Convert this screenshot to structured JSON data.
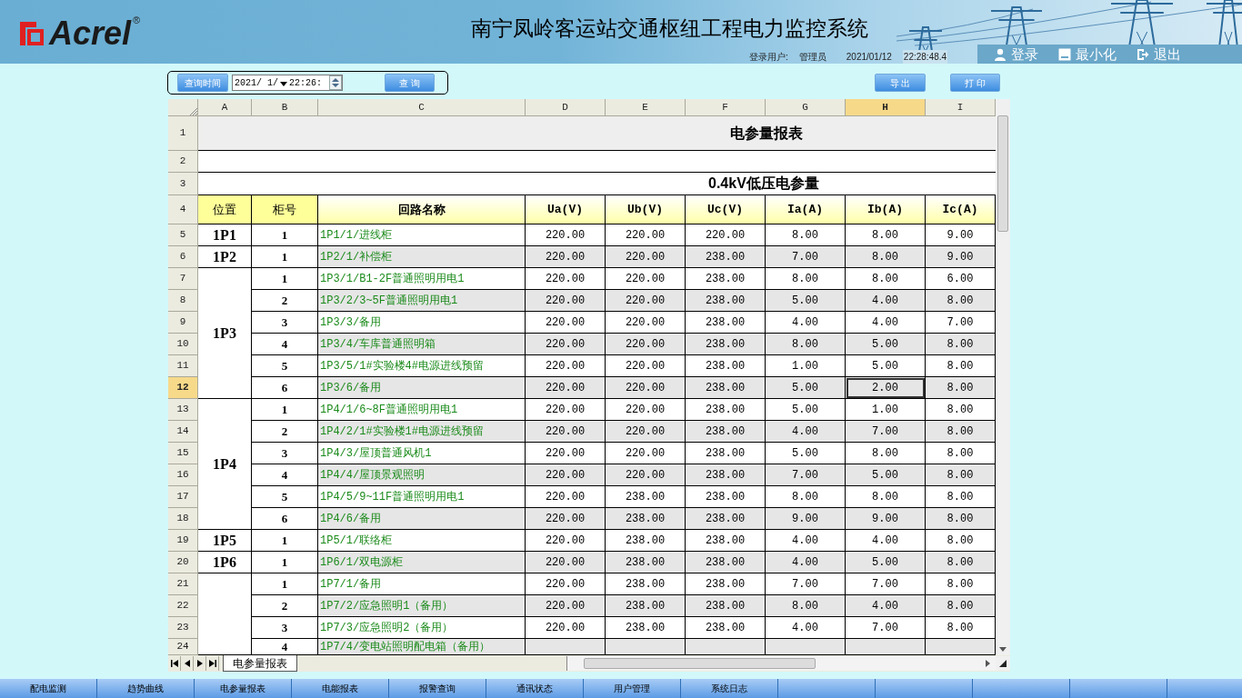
{
  "header": {
    "logo": "Acrel",
    "registered": "®",
    "title": "南宁凤岭客运站交通枢纽工程电力监控系统",
    "user_label": "登录用户:",
    "user": "管理员",
    "date": "2021/01/12",
    "time": "22:28:48.4",
    "actions": [
      {
        "kind": "login",
        "label": "登录"
      },
      {
        "kind": "minimize",
        "label": "最小化"
      },
      {
        "kind": "exit",
        "label": "退出"
      }
    ]
  },
  "toolbar": {
    "time_button": "查询时间",
    "date": "2021/ 1/",
    "time": "22:26:",
    "query_button": "查 询",
    "export_button": "导 出",
    "print_button": "打 印"
  },
  "sheet": {
    "columns": [
      {
        "letter": "A",
        "selected": false
      },
      {
        "letter": "B",
        "selected": false
      },
      {
        "letter": "C",
        "selected": false
      },
      {
        "letter": "D",
        "selected": false
      },
      {
        "letter": "E",
        "selected": false
      },
      {
        "letter": "F",
        "selected": false
      },
      {
        "letter": "G",
        "selected": false
      },
      {
        "letter": "H",
        "selected": true
      },
      {
        "letter": "I",
        "selected": false
      }
    ],
    "title_rows": [
      {
        "row": "1",
        "text": "电参量报表"
      },
      {
        "row": "2"
      },
      {
        "row": "3",
        "text": "0.4kV低压电参量"
      }
    ],
    "header_row": {
      "row": "4",
      "cells": [
        "位置",
        "柜号",
        "回路名称",
        "Ua(V)",
        "Ub(V)",
        "Uc(V)",
        "Ia(A)",
        "Ib(A)",
        "Ic(A)"
      ]
    },
    "groups": [
      {
        "position": "1P1",
        "rows": [
          {
            "row": "5",
            "selected": false,
            "cabinet": "1",
            "circuit": "1P1/1/进线柜",
            "values": [
              "220.00",
              "220.00",
              "220.00",
              "8.00",
              "8.00",
              "9.00"
            ]
          }
        ]
      },
      {
        "position": "1P2",
        "rows": [
          {
            "row": "6",
            "selected": false,
            "cabinet": "1",
            "circuit": "1P2/1/补偿柜",
            "values": [
              "220.00",
              "220.00",
              "238.00",
              "7.00",
              "8.00",
              "9.00"
            ]
          }
        ]
      },
      {
        "position": "1P3",
        "rows": [
          {
            "row": "7",
            "selected": false,
            "cabinet": "1",
            "circuit": "1P3/1/B1-2F普通照明用电1",
            "values": [
              "220.00",
              "220.00",
              "238.00",
              "8.00",
              "8.00",
              "6.00"
            ]
          },
          {
            "row": "8",
            "selected": false,
            "cabinet": "2",
            "circuit": "1P3/2/3~5F普通照明用电1",
            "values": [
              "220.00",
              "220.00",
              "238.00",
              "5.00",
              "4.00",
              "8.00"
            ]
          },
          {
            "row": "9",
            "selected": false,
            "cabinet": "3",
            "circuit": "1P3/3/备用",
            "values": [
              "220.00",
              "220.00",
              "238.00",
              "4.00",
              "4.00",
              "7.00"
            ]
          },
          {
            "row": "10",
            "selected": false,
            "cabinet": "4",
            "circuit": "1P3/4/车库普通照明箱",
            "values": [
              "220.00",
              "220.00",
              "238.00",
              "8.00",
              "5.00",
              "8.00"
            ]
          },
          {
            "row": "11",
            "selected": false,
            "cabinet": "5",
            "circuit": "1P3/5/1#实验楼4#电源进线预留",
            "values": [
              "220.00",
              "220.00",
              "238.00",
              "1.00",
              "5.00",
              "8.00"
            ]
          },
          {
            "row": "12",
            "selected": true,
            "cabinet": "6",
            "circuit": "1P3/6/备用",
            "values": [
              "220.00",
              "220.00",
              "238.00",
              "5.00",
              "2.00",
              "8.00"
            ]
          }
        ]
      },
      {
        "position": "1P4",
        "rows": [
          {
            "row": "13",
            "selected": false,
            "cabinet": "1",
            "circuit": "1P4/1/6~8F普通照明用电1",
            "values": [
              "220.00",
              "220.00",
              "238.00",
              "5.00",
              "1.00",
              "8.00"
            ]
          },
          {
            "row": "14",
            "selected": false,
            "cabinet": "2",
            "circuit": "1P4/2/1#实验楼1#电源进线预留",
            "values": [
              "220.00",
              "220.00",
              "238.00",
              "4.00",
              "7.00",
              "8.00"
            ]
          },
          {
            "row": "15",
            "selected": false,
            "cabinet": "3",
            "circuit": "1P4/3/屋顶普通风机1",
            "values": [
              "220.00",
              "220.00",
              "238.00",
              "5.00",
              "8.00",
              "8.00"
            ]
          },
          {
            "row": "16",
            "selected": false,
            "cabinet": "4",
            "circuit": "1P4/4/屋顶景观照明",
            "values": [
              "220.00",
              "220.00",
              "238.00",
              "7.00",
              "5.00",
              "8.00"
            ]
          },
          {
            "row": "17",
            "selected": false,
            "cabinet": "5",
            "circuit": "1P4/5/9~11F普通照明用电1",
            "values": [
              "220.00",
              "238.00",
              "238.00",
              "8.00",
              "8.00",
              "8.00"
            ]
          },
          {
            "row": "18",
            "selected": false,
            "cabinet": "6",
            "circuit": "1P4/6/备用",
            "values": [
              "220.00",
              "238.00",
              "238.00",
              "9.00",
              "9.00",
              "8.00"
            ]
          }
        ]
      },
      {
        "position": "1P5",
        "rows": [
          {
            "row": "19",
            "selected": false,
            "cabinet": "1",
            "circuit": "1P5/1/联络柜",
            "values": [
              "220.00",
              "238.00",
              "238.00",
              "4.00",
              "4.00",
              "8.00"
            ]
          }
        ]
      },
      {
        "position": "1P6",
        "rows": [
          {
            "row": "20",
            "selected": false,
            "cabinet": "1",
            "circuit": "1P6/1/双电源柜",
            "values": [
              "220.00",
              "238.00",
              "238.00",
              "4.00",
              "5.00",
              "8.00"
            ]
          }
        ]
      },
      {
        "rows": [
          {
            "row": "21",
            "selected": false,
            "cabinet": "1",
            "circuit": "1P7/1/备用",
            "values": [
              "220.00",
              "238.00",
              "238.00",
              "7.00",
              "7.00",
              "8.00"
            ]
          },
          {
            "row": "22",
            "selected": false,
            "cabinet": "2",
            "circuit": "1P7/2/应急照明1（备用）",
            "values": [
              "220.00",
              "238.00",
              "238.00",
              "8.00",
              "4.00",
              "8.00"
            ]
          },
          {
            "row": "23",
            "selected": false,
            "cabinet": "3",
            "circuit": "1P7/3/应急照明2（备用）",
            "values": [
              "220.00",
              "238.00",
              "238.00",
              "4.00",
              "7.00",
              "8.00"
            ]
          },
          {
            "row": "24",
            "selected": false,
            "cabinet": "4",
            "circuit": "1P7/4/变电站照明配电箱（备用）",
            "values": []
          }
        ]
      }
    ],
    "sheet_tab": {
      "label": "电参量报表",
      "selected": true
    }
  },
  "nav": [
    {
      "label": "配电监测"
    },
    {
      "label": "趋势曲线"
    },
    {
      "label": "电参量报表"
    },
    {
      "label": "电能报表"
    },
    {
      "label": "报警查询"
    },
    {
      "label": "通讯状态"
    },
    {
      "label": "用户管理"
    },
    {
      "label": "系统日志"
    }
  ]
}
